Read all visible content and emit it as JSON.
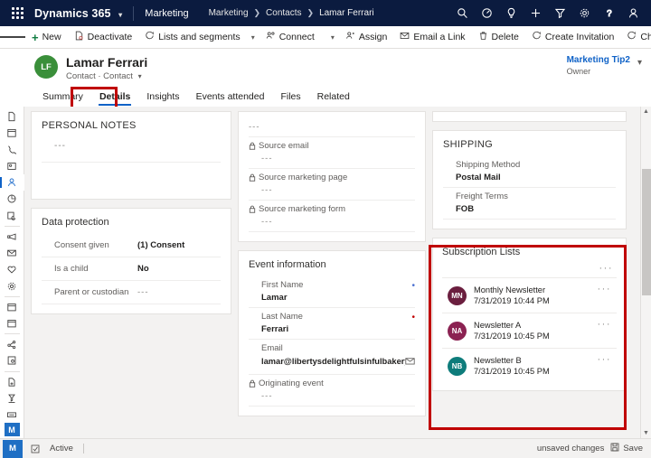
{
  "topbar": {
    "waffle": "waffle-menu",
    "brand": "Dynamics 365",
    "app_name": "Marketing",
    "breadcrumbs": [
      "Marketing",
      "Contacts",
      "Lamar Ferrari"
    ],
    "icons": [
      "search-icon",
      "speedometer-icon",
      "lightbulb-icon",
      "plus-icon",
      "filter-icon",
      "gear-icon",
      "help-icon",
      "account-icon"
    ]
  },
  "commandbar": {
    "menu": "hamburger-menu",
    "items": [
      {
        "label": "New",
        "icon": "plus-icon"
      },
      {
        "label": "Deactivate",
        "icon": "deactivate-icon"
      },
      {
        "label": "Lists and segments",
        "icon": "lists-icon",
        "caret": true
      },
      {
        "label": "Connect",
        "icon": "connect-icon",
        "caret": true
      },
      {
        "label": "Assign",
        "icon": "assign-icon"
      },
      {
        "label": "Email a Link",
        "icon": "email-link-icon"
      },
      {
        "label": "Delete",
        "icon": "trash-icon"
      },
      {
        "label": "Create Invitation",
        "icon": "invitation-icon"
      },
      {
        "label": "Change Password",
        "icon": "password-icon"
      }
    ],
    "overflow": "···"
  },
  "record": {
    "initials": "LF",
    "title": "Lamar Ferrari",
    "subtitle": "Contact · Contact",
    "owner_name": "Marketing Tip2",
    "owner_label": "Owner"
  },
  "tabs": [
    {
      "label": "Summary",
      "active": false
    },
    {
      "label": "Details",
      "active": true
    },
    {
      "label": "Insights",
      "active": false
    },
    {
      "label": "Events attended",
      "active": false
    },
    {
      "label": "Files",
      "active": false
    },
    {
      "label": "Related",
      "active": false
    }
  ],
  "sidebar": {
    "items": [
      "file-icon",
      "calendar-icon",
      "phone-icon",
      "contact-card-icon",
      "person-icon",
      "pie-chart-icon",
      "segment-icon",
      "megaphone-icon",
      "envelope-icon",
      "heart-icon",
      "settings-gear-icon",
      "calendar-event-icon",
      "calendar-blank-icon",
      "share-icon",
      "document-search-icon",
      "document-add-icon",
      "funnel-person-icon",
      "keyboard-icon"
    ],
    "selected_index": 4,
    "logo": "M"
  },
  "left_column": {
    "personal_notes": {
      "title": "PERSONAL NOTES",
      "value": "---"
    },
    "data_protection": {
      "title": "Data protection",
      "rows": [
        {
          "label": "Consent given",
          "value": "(1) Consent",
          "dim": false
        },
        {
          "label": "Is a child",
          "value": "No",
          "dim": false
        },
        {
          "label": "Parent or custodian",
          "value": "---",
          "dim": true
        }
      ]
    }
  },
  "middle_column": {
    "source_card": {
      "top_value": "---",
      "fields": [
        {
          "label": "Source email",
          "value": "---",
          "locked": true
        },
        {
          "label": "Source marketing page",
          "value": "---",
          "locked": true
        },
        {
          "label": "Source marketing form",
          "value": "---",
          "locked": true
        }
      ]
    },
    "event_information": {
      "title": "Event information",
      "fields": [
        {
          "label": "First Name",
          "value": "Lamar",
          "locked": false,
          "required": "blue"
        },
        {
          "label": "Last Name",
          "value": "Ferrari",
          "locked": false,
          "required": "red"
        },
        {
          "label": "Email",
          "value": "lamar@libertysdelightfulsinfulbakeryandcaf...",
          "locked": false,
          "icon": "envelope-icon"
        },
        {
          "label": "Originating event",
          "value": "---",
          "locked": true
        }
      ]
    }
  },
  "right_column": {
    "shipping": {
      "title": "SHIPPING",
      "fields": [
        {
          "label": "Shipping Method",
          "value": "Postal Mail"
        },
        {
          "label": "Freight Terms",
          "value": "FOB"
        }
      ]
    },
    "subscription_lists": {
      "title": "Subscription Lists",
      "overflow": "···",
      "items": [
        {
          "initials": "MN",
          "name": "Monthly Newsletter",
          "date": "7/31/2019 10:44 PM",
          "color": "#6b1f3f",
          "overflow": "···"
        },
        {
          "initials": "NA",
          "name": "Newsletter A",
          "date": "7/31/2019 10:45 PM",
          "color": "#8b2252",
          "overflow": "···"
        },
        {
          "initials": "NB",
          "name": "Newsletter B",
          "date": "7/31/2019 10:45 PM",
          "color": "#0e7c7b",
          "overflow": "···"
        }
      ]
    }
  },
  "statusbar": {
    "logo": "M",
    "refresh_icon": "refresh-icon",
    "status": "Active",
    "unsaved": "unsaved changes",
    "save_label": "Save",
    "save_icon": "save-icon"
  },
  "colors": {
    "nav_background": "#0b1b3f",
    "accent_blue": "#0f62c7",
    "highlight_red": "#c00000",
    "avatar_green": "#3a8f3a",
    "new_green": "#107c41"
  }
}
